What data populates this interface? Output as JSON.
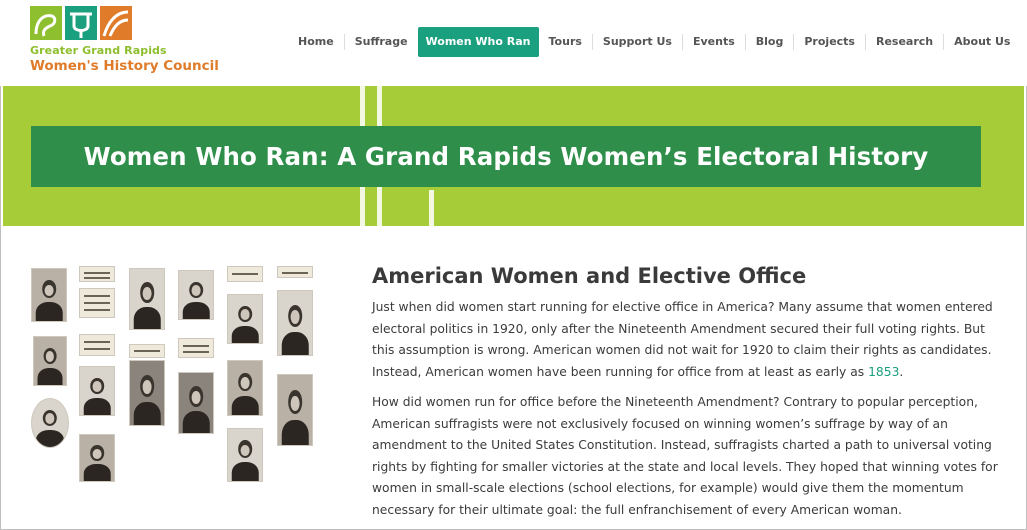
{
  "logo": {
    "line1": "Greater Grand Rapids",
    "line2": "Women's History Council",
    "colors": {
      "green": "#8dbf2e",
      "teal": "#1a9f7f",
      "orange": "#e07b2a"
    }
  },
  "nav": {
    "items": [
      {
        "label": "Home",
        "active": false
      },
      {
        "label": "Suffrage",
        "active": false
      },
      {
        "label": "Women Who Ran",
        "active": true
      },
      {
        "label": "Tours",
        "active": false
      },
      {
        "label": "Support Us",
        "active": false
      },
      {
        "label": "Events",
        "active": false
      },
      {
        "label": "Blog",
        "active": false
      },
      {
        "label": "Projects",
        "active": false
      },
      {
        "label": "Research",
        "active": false
      },
      {
        "label": "About Us",
        "active": false
      }
    ],
    "search_icon": "search-icon"
  },
  "banner": {
    "title": "Women Who Ran: A Grand Rapids Women’s Electoral History",
    "background": "#a6cc38",
    "title_background": "#2f8f4a"
  },
  "main": {
    "heading": "American Women and Elective Office",
    "para1_before_link": "Just when did women start running for elective office in America? Many assume that women entered electoral politics in 1920, only after the Nineteenth Amendment secured their full voting rights. But this assumption is wrong. American women did not wait for 1920 to claim their rights as candidates. Instead, American women have been running for office from at least as early as ",
    "para1_link": "1853",
    "para1_after_link": ".",
    "para2": "How did women run for office before the Nineteenth Amendment? Contrary to popular perception, American suffragists were not exclusively focused on winning women’s suffrage by way of an amendment to the United States Constitution. Instead, suffragists charted a path to universal voting rights by fighting for smaller victories at the state and local levels. They hoped that winning votes for women in small-scale elections (school elections, for example) would give them the momentum necessary for their ultimate goal: the full enfranchisement of every American woman."
  }
}
